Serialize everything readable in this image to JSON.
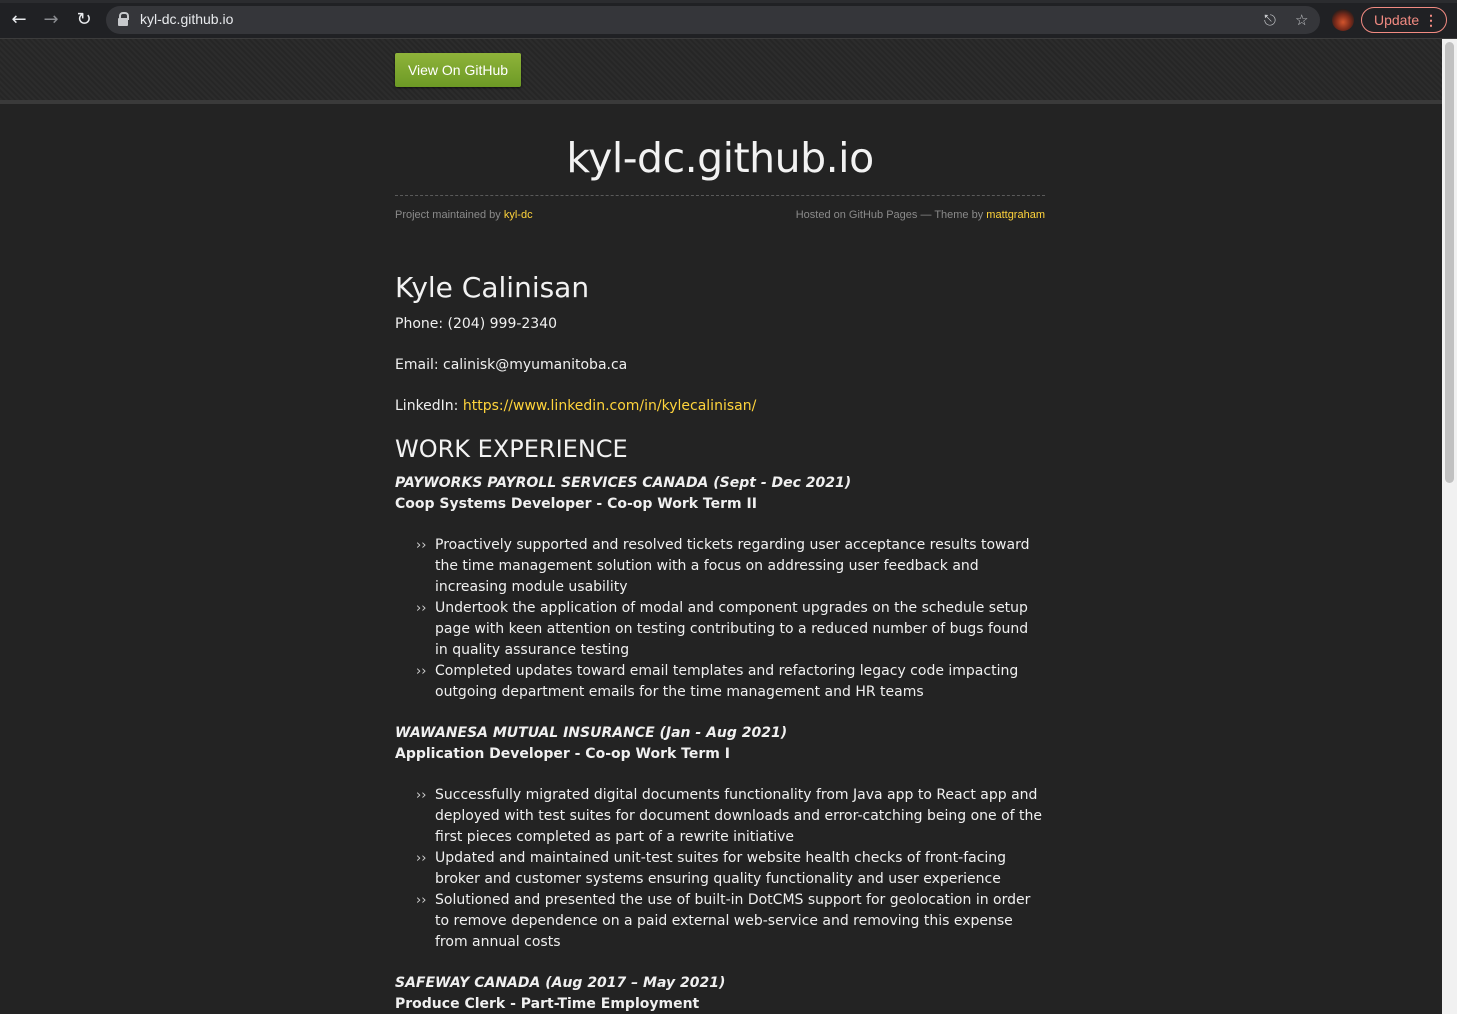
{
  "browser": {
    "url": "kyl-dc.github.io",
    "update_label": "Update"
  },
  "header": {
    "github_button": "View On GitHub"
  },
  "site": {
    "title": "kyl-dc.github.io",
    "maintained_prefix": "Project maintained by",
    "maintainer": "kyl-dc",
    "hosted_text": "Hosted on GitHub Pages — Theme by",
    "theme_author": "mattgraham"
  },
  "resume": {
    "name": "Kyle Calinisan",
    "phone": "Phone: (204) 999-2340",
    "email": "Email: calinisk@myumanitoba.ca",
    "linkedin_label": "LinkedIn:",
    "linkedin_url": "https://www.linkedin.com/in/kylecalinisan/",
    "section_work": "WORK EXPERIENCE",
    "jobs": [
      {
        "employer": "PAYWORKS PAYROLL SERVICES CANADA (Sept - Dec 2021)",
        "role": "Coop Systems Developer - Co-op Work Term II",
        "bullets": [
          "Proactively supported and resolved tickets regarding user acceptance results toward the time management solution with a focus on addressing user feedback and increasing module usability",
          "Undertook the application of modal and component upgrades on the schedule setup page with keen attention on testing contributing to a reduced number of bugs found in quality assurance testing",
          "Completed updates toward email templates and refactoring legacy code impacting outgoing department emails for the time management and HR teams"
        ]
      },
      {
        "employer": "WAWANESA MUTUAL INSURANCE (Jan - Aug 2021)",
        "role": "Application Developer - Co-op Work Term I",
        "bullets": [
          "Successfully migrated digital documents functionality from Java app to React app and deployed with test suites for document downloads and error-catching being one of the first pieces completed as part of a rewrite initiative",
          "Updated and maintained unit-test suites for website health checks of front-facing broker and customer systems ensuring quality functionality and user experience",
          "Solutioned and presented the use of built-in DotCMS support for geolocation in order to remove dependence on a paid external web-service and removing this expense from annual costs"
        ]
      },
      {
        "employer": "SAFEWAY CANADA (Aug 2017 – May 2021)",
        "role": "Produce Clerk - Part-Time Employment",
        "bullets": []
      }
    ]
  }
}
